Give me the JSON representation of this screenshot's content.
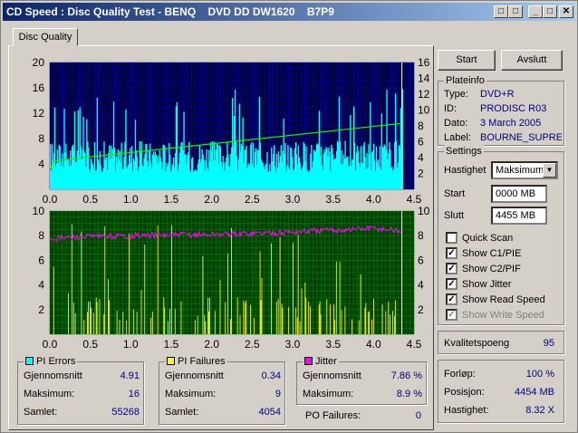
{
  "window": {
    "title": "CD Speed : Disc Quality Test - BENQ    DVD DD DW1620    B7P9",
    "buttons": [
      "□",
      "_",
      "□",
      "✕"
    ]
  },
  "tab": {
    "label": "Disc Quality"
  },
  "buttons": {
    "start": "Start",
    "exit": "Avslutt"
  },
  "plateinfo": {
    "title": "Plateinfo",
    "rows": [
      {
        "label": "Type:",
        "value": "DVD+R"
      },
      {
        "label": "ID:",
        "value": "PRODISC R03"
      },
      {
        "label": "Dato:",
        "value": "3 March 2005"
      },
      {
        "label": "Label:",
        "value": "BOURNE_SUPRE"
      }
    ]
  },
  "settings": {
    "title": "Settings",
    "speed_label": "Hastighet",
    "speed_value": "Maksimum",
    "start_label": "Start",
    "start_value": "0000 MB",
    "end_label": "Slutt",
    "end_value": "4455 MB",
    "checks": [
      {
        "label": "Quick Scan",
        "checked": false,
        "disabled": false
      },
      {
        "label": "Show C1/PIE",
        "checked": true,
        "disabled": false
      },
      {
        "label": "Show C2/PIF",
        "checked": true,
        "disabled": false
      },
      {
        "label": "Show Jitter",
        "checked": true,
        "disabled": false
      },
      {
        "label": "Show Read Speed",
        "checked": true,
        "disabled": false
      },
      {
        "label": "Show Write Speed",
        "checked": true,
        "disabled": true
      }
    ]
  },
  "quality": {
    "label": "Kvalitetspoeng",
    "value": "95"
  },
  "progress": {
    "rows": [
      {
        "label": "Forløp:",
        "value": "100 %"
      },
      {
        "label": "Posisjon:",
        "value": "4454 MB"
      },
      {
        "label": "Hastighet:",
        "value": "8.32 X"
      }
    ]
  },
  "pi_errors": {
    "title": "PI Errors",
    "color": "#00ffff",
    "rows": [
      {
        "label": "Gjennomsnitt",
        "value": "4.91"
      },
      {
        "label": "Maksimum:",
        "value": "16"
      },
      {
        "label": "Samlet:",
        "value": "55268"
      }
    ]
  },
  "pi_failures": {
    "title": "PI Failures",
    "color": "#ffff00",
    "rows": [
      {
        "label": "Gjennomsnitt",
        "value": "0.34"
      },
      {
        "label": "Maksimum:",
        "value": "9"
      },
      {
        "label": "Samlet:",
        "value": "4054"
      }
    ]
  },
  "jitter": {
    "title": "Jitter",
    "color": "#ff00ff",
    "rows": [
      {
        "label": "Gjennomsnitt",
        "value": "7.86 %"
      },
      {
        "label": "Maksimum:",
        "value": "8.9 %"
      }
    ]
  },
  "po_failures": {
    "label": "PO Failures:",
    "value": "0"
  },
  "chart_data": [
    {
      "type": "area",
      "name": "PI Errors",
      "xlim": [
        0,
        4.5
      ],
      "ylim_left": [
        0,
        20
      ],
      "ylim_right": [
        0,
        16
      ],
      "x_ticks": [
        "0.0",
        "0.5",
        "1.0",
        "1.5",
        "2.0",
        "2.5",
        "3.0",
        "3.5",
        "4.0",
        "4.5"
      ],
      "y_ticks_left": [
        "4",
        "8",
        "12",
        "16",
        "20"
      ],
      "y_ticks_right": [
        "2",
        "4",
        "6",
        "8",
        "10",
        "12",
        "14",
        "16"
      ],
      "colors": {
        "background": "#000040",
        "grid": "#0000c0",
        "errors": "#00ffff",
        "speed": "#00ff00"
      },
      "errors_summary": {
        "average": 4.91,
        "max": 16
      },
      "read_speed": {
        "x": [
          0,
          0.05,
          4.35
        ],
        "y": [
          2.4,
          3.6,
          8.32
        ]
      }
    },
    {
      "type": "bar",
      "name": "PI Failures / Jitter",
      "xlim": [
        0,
        4.5
      ],
      "ylim_left": [
        0,
        10
      ],
      "ylim_right": [
        0,
        10
      ],
      "x_ticks": [
        "0.0",
        "0.5",
        "1.0",
        "1.5",
        "2.0",
        "2.5",
        "3.0",
        "3.5",
        "4.0",
        "4.5"
      ],
      "y_ticks_left": [
        "2",
        "4",
        "6",
        "8",
        "10"
      ],
      "y_ticks_right": [
        "2",
        "4",
        "6",
        "8",
        "10"
      ],
      "colors": {
        "background": "#004000",
        "grid": "#008000",
        "failures": "#ffff00",
        "jitter": "#ff00ff"
      },
      "failures_summary": {
        "average": 0.34,
        "max": 9
      },
      "jitter": {
        "x": [
          0,
          1,
          2,
          3,
          4,
          4.35
        ],
        "y": [
          7.8,
          8.0,
          8.1,
          8.3,
          8.6,
          8.4
        ]
      }
    }
  ]
}
